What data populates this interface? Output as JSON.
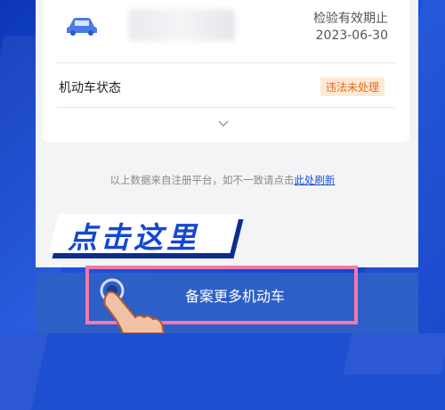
{
  "vehicle": {
    "expiry_label": "检验有效期止",
    "expiry_date": "2023-06-30",
    "status_label": "机动车状态",
    "status_value": "违法未处理"
  },
  "note": {
    "text": "以上数据来自注册平台，如不一致请点击",
    "link": "此处刷新"
  },
  "overlay": {
    "click_here": "点击这里"
  },
  "cta": {
    "label": "备案更多机动车"
  },
  "colors": {
    "primary_blue": "#1d52d8",
    "badge_text": "#e46a1c",
    "badge_bg": "#fde9d6",
    "highlight_pink": "#f07aa8",
    "footer_blue": "#2d5fc6"
  },
  "icons": [
    "car-icon",
    "chevron-down-icon",
    "tap-hand-icon"
  ]
}
